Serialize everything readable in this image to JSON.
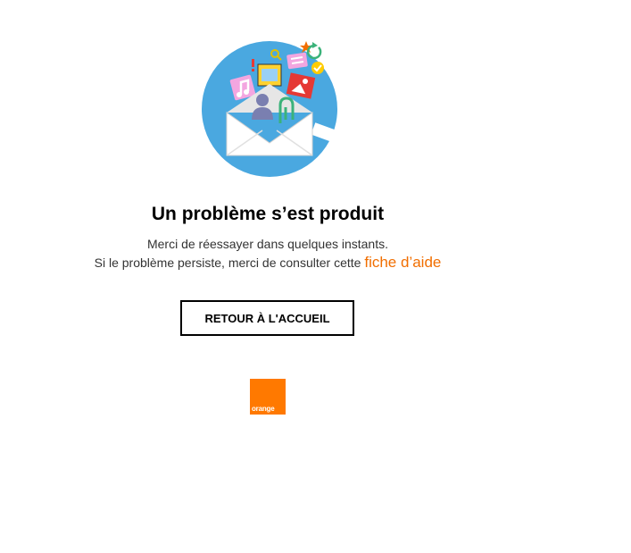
{
  "error": {
    "title": "Un problème s’est produit",
    "message_line1": "Merci de réessayer dans quelques instants.",
    "message_line2_prefix": "Si le problème persiste, merci de consulter cette ",
    "help_link_label": "fiche d’aide"
  },
  "actions": {
    "home_button_label": "RETOUR À L'ACCUEIL"
  },
  "brand": {
    "logo_text": "orange",
    "logo_color": "#ff7900",
    "accent_link_color": "#f16e00",
    "illustration_circle_color": "#4aa8e0"
  },
  "illustration": {
    "icons": [
      "envelope-icon",
      "music-note-icon",
      "film-icon",
      "image-icon",
      "user-icon",
      "paperclip-icon",
      "magnifier-icon",
      "chat-bubble-icon",
      "checkmark-icon",
      "refresh-icon",
      "star-icon",
      "exclamation-icon"
    ]
  }
}
